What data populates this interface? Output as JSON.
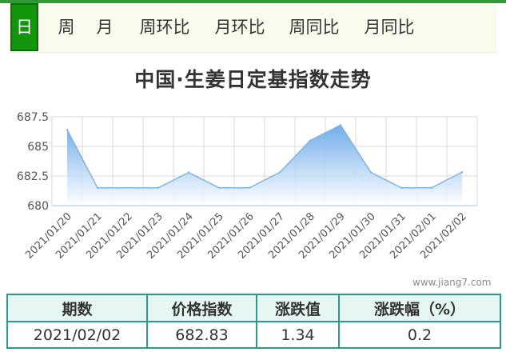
{
  "tabs": [
    {
      "label": "日",
      "active": true
    },
    {
      "label": "周",
      "active": false
    },
    {
      "label": "月",
      "active": false
    },
    {
      "label": "周环比",
      "active": false
    },
    {
      "label": "月环比",
      "active": false
    },
    {
      "label": "周同比",
      "active": false
    },
    {
      "label": "月同比",
      "active": false
    }
  ],
  "watermark": "www.jiang7.com",
  "colors": {
    "tab_active": "#12960c",
    "line": "#7db4e8",
    "area_top": "#6aa8e8",
    "area_bottom": "#ffffff",
    "table_border": "#2a9a8a",
    "table_header": "#e6f7f3"
  },
  "chart_data": {
    "type": "area",
    "title": "中国·生姜日定基指数走势",
    "xlabel": "",
    "ylabel": "",
    "ylim": [
      680,
      687.5
    ],
    "yticks": [
      "687.5",
      "685",
      "682.5",
      "680"
    ],
    "grid": true,
    "categories": [
      "2021/01/20",
      "2021/01/21",
      "2021/01/22",
      "2021/01/23",
      "2021/01/24",
      "2021/01/25",
      "2021/01/26",
      "2021/01/27",
      "2021/01/28",
      "2021/01/29",
      "2021/01/30",
      "2021/01/31",
      "2021/02/01",
      "2021/02/02"
    ],
    "values": [
      686.4,
      681.5,
      681.5,
      681.5,
      682.8,
      681.5,
      681.5,
      682.8,
      685.5,
      686.8,
      682.8,
      681.5,
      681.5,
      682.83
    ]
  },
  "table": {
    "headers": [
      "期数",
      "价格指数",
      "涨跌值",
      "涨跌幅（%）"
    ],
    "row": [
      "2021/02/02",
      "682.83",
      "1.34",
      "0.2"
    ]
  }
}
